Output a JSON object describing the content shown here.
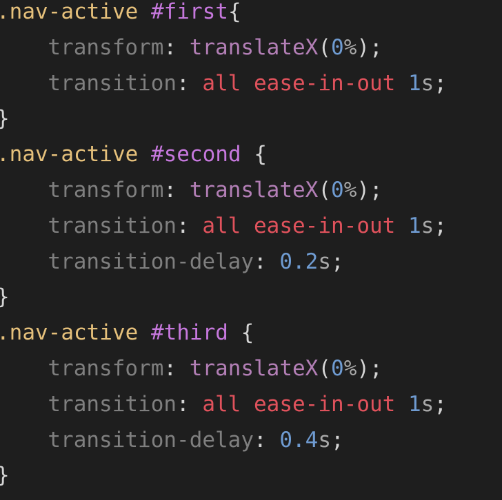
{
  "code": {
    "rules": [
      {
        "selector": ".nav-active",
        "id": "#first",
        "open": "{",
        "decls": [
          {
            "prop": "transform",
            "fn": "translateX",
            "arg_num": "0",
            "arg_unit": "%"
          },
          {
            "prop": "transition",
            "kw": "all ease-in-out",
            "num": "1",
            "unit": "s"
          }
        ],
        "close": "}"
      },
      {
        "selector": ".nav-active",
        "id": "#second",
        "open": "{",
        "decls": [
          {
            "prop": "transform",
            "fn": "translateX",
            "arg_num": "0",
            "arg_unit": "%"
          },
          {
            "prop": "transition",
            "kw": "all ease-in-out",
            "num": "1",
            "unit": "s"
          },
          {
            "prop": "transition-delay",
            "num": "0.2",
            "unit": "s"
          }
        ],
        "close": "}"
      },
      {
        "selector": ".nav-active",
        "id": "#third",
        "open": "{",
        "decls": [
          {
            "prop": "transform",
            "fn": "translateX",
            "arg_num": "0",
            "arg_unit": "%"
          },
          {
            "prop": "transition",
            "kw": "all ease-in-out",
            "num": "1",
            "unit": "s"
          },
          {
            "prop": "transition-delay",
            "num": "0.4",
            "unit": "s"
          }
        ],
        "close": "}"
      }
    ],
    "colors": {
      "background": "#1e1e1e",
      "selector": "#e5c07b",
      "id_selector": "#c678dd",
      "property": "#7f7f7f",
      "function": "#b37fb6",
      "number": "#6f9bd1",
      "keyword": "#e0525c"
    }
  }
}
